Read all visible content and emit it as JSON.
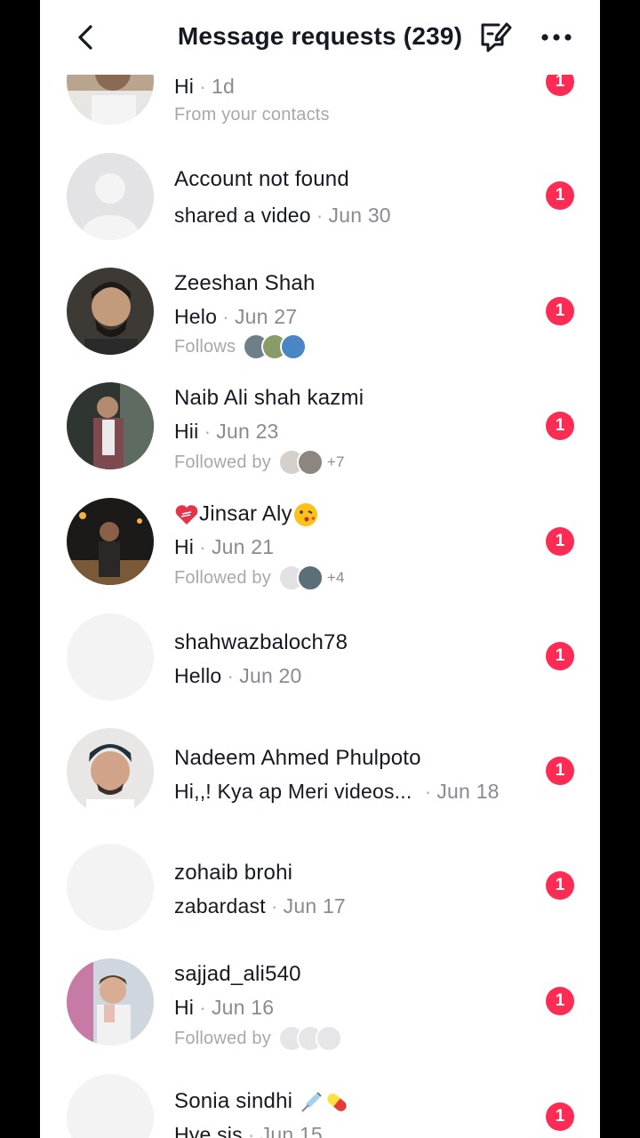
{
  "header": {
    "title": "Message requests (239)",
    "back_icon": "chevron-left-icon",
    "compose_icon": "chat-bubble-edit-icon",
    "more_icon": "more-horizontal-icon"
  },
  "colors": {
    "badge": "#fe2c55",
    "muted": "#8a8b91",
    "text": "#161823"
  },
  "requests": [
    {
      "name": "",
      "message": "Hi",
      "date": "1d",
      "meta": "From your contacts",
      "unread": "1"
    },
    {
      "name": "Account not found",
      "message": "shared a video",
      "date": "Jun 30",
      "meta": "",
      "unread": "1"
    },
    {
      "name": "Zeeshan Shah",
      "message": "Helo",
      "date": "Jun 27",
      "meta": "Follows",
      "unread": "1"
    },
    {
      "name": "Naib Ali shah kazmi",
      "message": "Hii",
      "date": "Jun 23",
      "meta": "Followed by",
      "meta_extra": "+7",
      "unread": "1"
    },
    {
      "name": "Jinsar Aly",
      "message": "Hi",
      "date": "Jun 21",
      "meta": "Followed by",
      "meta_extra": "+4",
      "unread": "1"
    },
    {
      "name": "shahwazbaloch78",
      "message": "Hello",
      "date": "Jun 20",
      "meta": "",
      "unread": "1"
    },
    {
      "name": "Nadeem Ahmed Phulpoto",
      "message": "Hi,,! Kya ap Meri videos...",
      "date": "Jun 18",
      "meta": "",
      "unread": "1"
    },
    {
      "name": "zohaib brohi",
      "message": "zabardast",
      "date": "Jun 17",
      "meta": "",
      "unread": "1"
    },
    {
      "name": "sajjad_ali540",
      "message": "Hi",
      "date": "Jun 16",
      "meta": "Followed by",
      "unread": "1"
    },
    {
      "name": "Sonia sindhi",
      "message": "Hye sis",
      "date": "Jun 15",
      "meta": "",
      "unread": "1"
    }
  ]
}
